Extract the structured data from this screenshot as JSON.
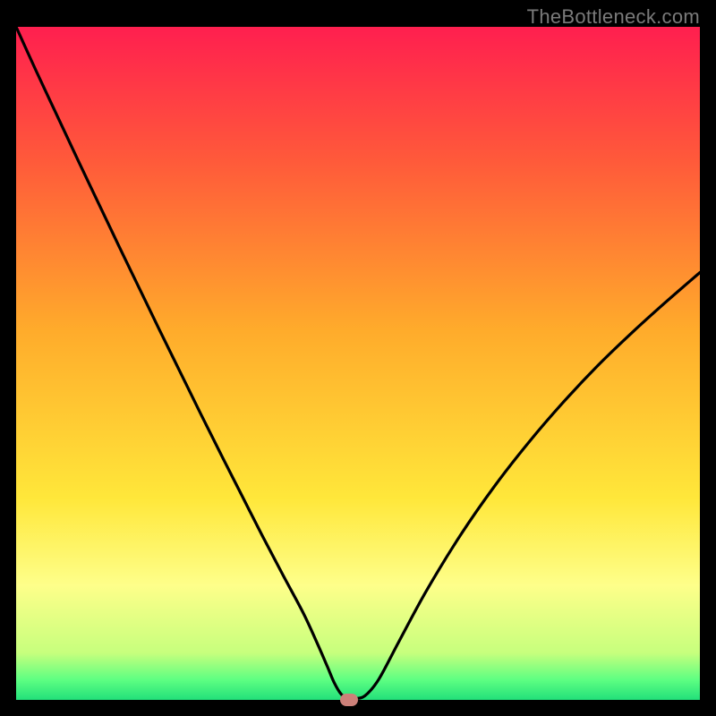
{
  "watermark": "TheBottleneck.com",
  "chart_data": {
    "type": "line",
    "title": "",
    "xlabel": "",
    "ylabel": "",
    "xlim": [
      0,
      100
    ],
    "ylim": [
      0,
      100
    ],
    "background": {
      "gradient_stops": [
        {
          "offset": 0.0,
          "color": "#ff1f4f"
        },
        {
          "offset": 0.2,
          "color": "#ff5a3a"
        },
        {
          "offset": 0.45,
          "color": "#ffab2b"
        },
        {
          "offset": 0.7,
          "color": "#ffe73a"
        },
        {
          "offset": 0.83,
          "color": "#feff8a"
        },
        {
          "offset": 0.93,
          "color": "#c7ff7d"
        },
        {
          "offset": 0.97,
          "color": "#5eff82"
        },
        {
          "offset": 1.0,
          "color": "#22e07a"
        }
      ]
    },
    "series": [
      {
        "name": "bottleneck-curve",
        "x": [
          0.0,
          3.0,
          6.0,
          9.0,
          12.0,
          15.0,
          18.0,
          21.0,
          24.0,
          27.0,
          30.0,
          33.0,
          36.0,
          39.0,
          42.0,
          44.0,
          45.5,
          46.5,
          47.5,
          48.5,
          49.5,
          51.0,
          53.0,
          56.0,
          60.0,
          65.0,
          70.0,
          75.0,
          80.0,
          85.0,
          90.0,
          95.0,
          100.0
        ],
        "y": [
          100.0,
          93.3,
          86.8,
          80.3,
          73.9,
          67.5,
          61.2,
          54.9,
          48.7,
          42.5,
          36.4,
          30.4,
          24.4,
          18.6,
          12.9,
          8.5,
          5.0,
          2.6,
          0.9,
          0.2,
          0.2,
          0.6,
          3.0,
          8.7,
          16.2,
          24.5,
          31.8,
          38.3,
          44.2,
          49.6,
          54.5,
          59.1,
          63.5
        ]
      }
    ],
    "marker": {
      "x": 48.7,
      "y": 0.0,
      "color": "#cc8079"
    }
  }
}
